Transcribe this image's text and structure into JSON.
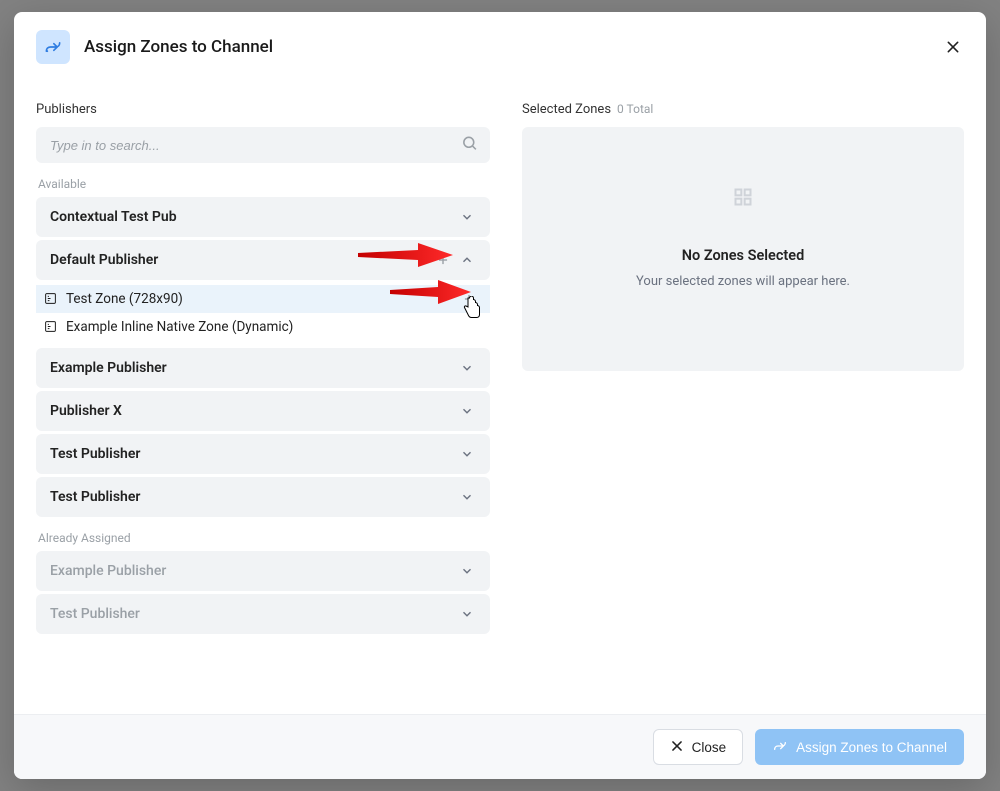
{
  "header": {
    "title": "Assign Zones to Channel"
  },
  "left": {
    "label": "Publishers",
    "search_placeholder": "Type in to search...",
    "available_label": "Available",
    "publishers": [
      {
        "name": "Contextual Test Pub",
        "expanded": false
      },
      {
        "name": "Default Publisher",
        "expanded": true,
        "zones": [
          {
            "name": "Test Zone (728x90)"
          },
          {
            "name": "Example Inline Native Zone (Dynamic)"
          }
        ]
      },
      {
        "name": "Example Publisher",
        "expanded": false
      },
      {
        "name": "Publisher X",
        "expanded": false
      },
      {
        "name": "Test Publisher",
        "expanded": false
      },
      {
        "name": "Test Publisher",
        "expanded": false
      }
    ],
    "already_assigned_label": "Already Assigned",
    "assigned": [
      {
        "name": "Example Publisher"
      },
      {
        "name": "Test Publisher"
      }
    ]
  },
  "right": {
    "label": "Selected Zones",
    "count_text": "0 Total",
    "empty_title": "No Zones Selected",
    "empty_sub": "Your selected zones will appear here."
  },
  "footer": {
    "close_label": "Close",
    "submit_label": "Assign Zones to Channel"
  }
}
